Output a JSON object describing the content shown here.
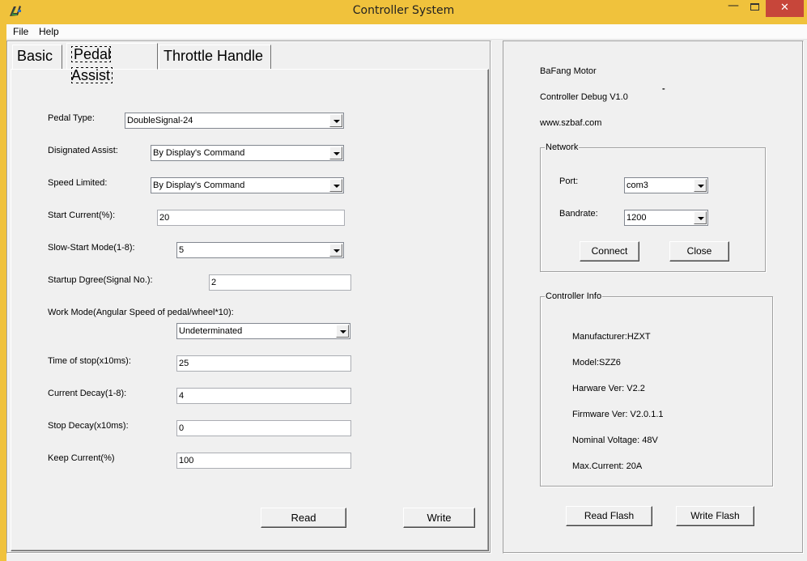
{
  "window": {
    "title": "Controller System",
    "minimize": "—",
    "close": "✕"
  },
  "menu": {
    "file": "File",
    "help": "Help"
  },
  "tabs": {
    "basic": "Basic",
    "pedal_assist": "Pedal Assist",
    "throttle_handle": "Throttle Handle"
  },
  "pedal_assist": {
    "pedal_type": {
      "label": "Pedal Type:",
      "value": "DoubleSignal-24"
    },
    "designated_assist": {
      "label": "Disignated Assist:",
      "value": "By Display's Command"
    },
    "speed_limited": {
      "label": "Speed Limited:",
      "value": "By Display's Command"
    },
    "start_current": {
      "label": "Start Current(%):",
      "value": "20"
    },
    "slow_start_mode": {
      "label": "Slow-Start Mode(1-8):",
      "value": "5"
    },
    "startup_degree": {
      "label": "Startup Dgree(Signal No.):",
      "value": "2"
    },
    "work_mode": {
      "label": "Work Mode(Angular Speed of pedal/wheel*10):",
      "value": "Undeterminated"
    },
    "time_of_stop": {
      "label": "Time of stop(x10ms):",
      "value": "25"
    },
    "current_decay": {
      "label": "Current Decay(1-8):",
      "value": "4"
    },
    "stop_decay": {
      "label": "Stop Decay(x10ms):",
      "value": "0"
    },
    "keep_current": {
      "label": "Keep Current(%)",
      "value": "100"
    },
    "read_button": "Read",
    "write_button": "Write"
  },
  "about": {
    "company": "BaFang Motor",
    "product": "Controller Debug V1.0",
    "website": "www.szbaf.com",
    "mark": "'''''"
  },
  "network": {
    "title": "Network",
    "port_label": "Port:",
    "port_value": "com3",
    "baudrate_label": "Bandrate:",
    "baudrate_value": "1200",
    "connect_button": "Connect",
    "close_button": "Close"
  },
  "controller_info": {
    "title": "Controller Info",
    "manufacturer": "Manufacturer:HZXT",
    "model": "Model:SZZ6",
    "hardware_ver": "Harware Ver: V2.2",
    "firmware_ver": "Firmware Ver: V2.0.1.1",
    "nominal_voltage": "Nominal Voltage: 48V",
    "max_current": "Max.Current: 20A"
  },
  "flash": {
    "read_button": "Read Flash",
    "write_button": "Write Flash"
  },
  "colors": {
    "title_bar": "#f0c23c",
    "window_bg": "#f0f0f0",
    "close_button": "#c7463a"
  }
}
